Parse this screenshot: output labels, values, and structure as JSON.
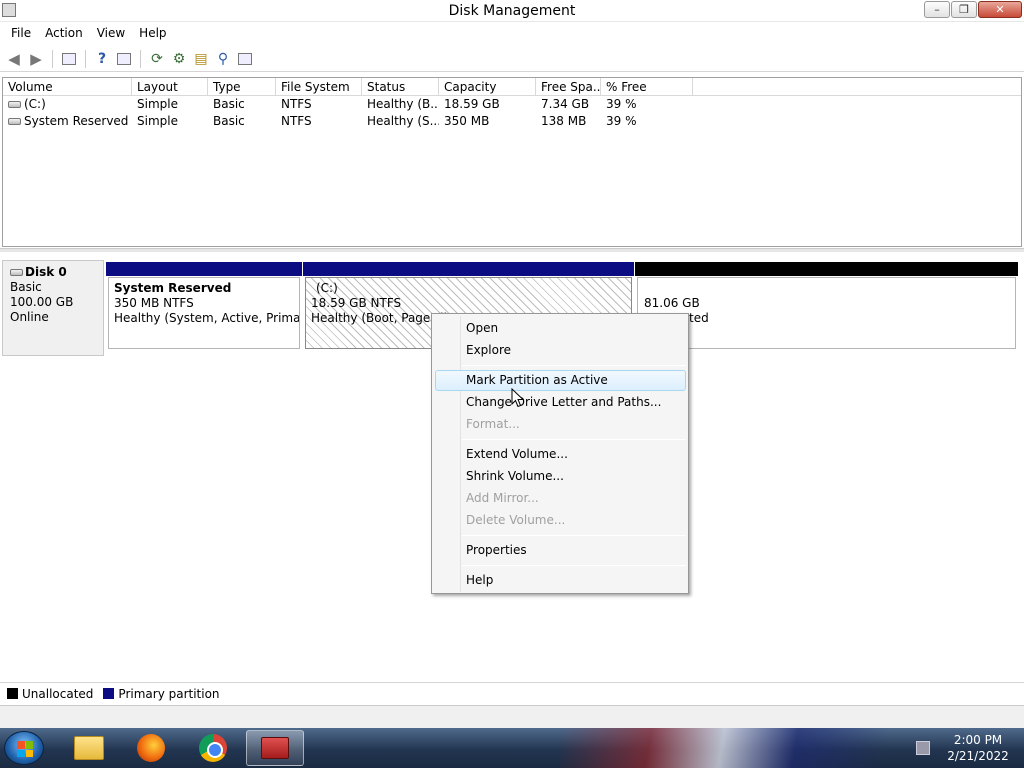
{
  "window": {
    "title": "Disk Management"
  },
  "menubar": [
    "File",
    "Action",
    "View",
    "Help"
  ],
  "volume_list": {
    "columns": [
      "Volume",
      "Layout",
      "Type",
      "File System",
      "Status",
      "Capacity",
      "Free Spa...",
      "% Free"
    ],
    "rows": [
      [
        "(C:)",
        "Simple",
        "Basic",
        "NTFS",
        "Healthy (B...",
        "18.59 GB",
        "7.34 GB",
        "39 %"
      ],
      [
        "System Reserved",
        "Simple",
        "Basic",
        "NTFS",
        "Healthy (S...",
        "350 MB",
        "138 MB",
        "39 %"
      ]
    ]
  },
  "disk": {
    "name": "Disk 0",
    "type": "Basic",
    "size": "100.00 GB",
    "status": "Online",
    "partitions": [
      {
        "name": "System Reserved",
        "size": "350 MB NTFS",
        "status": "Healthy (System, Active, Primary P"
      },
      {
        "name": "(C:)",
        "size": "18.59 GB NTFS",
        "status": "Healthy (Boot, Page Fil"
      },
      {
        "size": "81.06 GB",
        "status": "ted"
      }
    ]
  },
  "context_menu": {
    "items": [
      {
        "label": "Open",
        "disabled": false
      },
      {
        "label": "Explore",
        "disabled": false
      },
      {
        "label": "Mark Partition as Active",
        "disabled": false,
        "highlighted": true
      },
      {
        "label": "Change Drive Letter and Paths...",
        "disabled": false
      },
      {
        "label": "Format...",
        "disabled": true
      },
      {
        "label": "Extend Volume...",
        "disabled": false
      },
      {
        "label": "Shrink Volume...",
        "disabled": false
      },
      {
        "label": "Add Mirror...",
        "disabled": true
      },
      {
        "label": "Delete Volume...",
        "disabled": true
      },
      {
        "label": "Properties",
        "disabled": false
      },
      {
        "label": "Help",
        "disabled": false
      }
    ]
  },
  "legend": {
    "unallocated": "Unallocated",
    "primary": "Primary partition"
  },
  "colors": {
    "primary_partition": "#0b0b82",
    "unallocated": "#000000",
    "highlight": "#dcefff"
  },
  "clock": {
    "time": "2:00 PM",
    "date": "2/21/2022"
  },
  "icons": [
    "back-icon",
    "forward-icon",
    "console-tree-icon",
    "help-icon",
    "refresh-icon",
    "properties-icon",
    "open-folder-icon",
    "search-icon",
    "settings-icon",
    "windows-start-icon",
    "folder-icon",
    "firefox-icon",
    "chrome-icon",
    "disk-management-icon",
    "network-icon"
  ]
}
